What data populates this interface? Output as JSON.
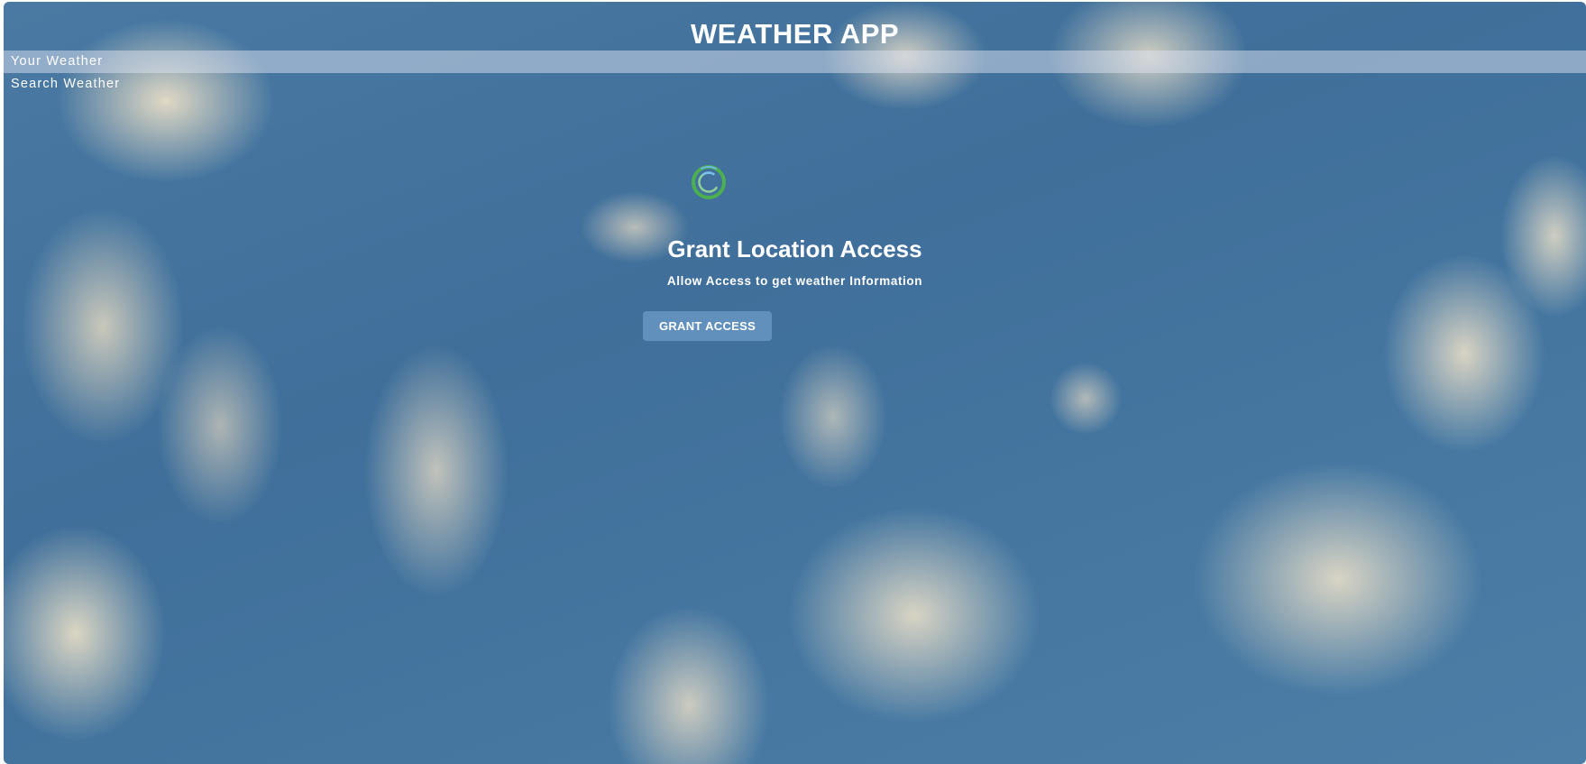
{
  "app": {
    "title": "WEATHER APP"
  },
  "tabs": [
    {
      "label": "Your Weather",
      "active": true
    },
    {
      "label": "Search Weather",
      "active": false
    }
  ],
  "grant": {
    "icon": "location-radar-icon",
    "title": "Grant Location Access",
    "subtitle": "Allow Access to get weather Information",
    "button_label": "GRANT ACCESS"
  },
  "colors": {
    "sky": "#4577a1",
    "icon_green": "#4caf50",
    "icon_blue": "#6fb7e8",
    "button_bg": "#6e9bc8",
    "tab_active_bg": "#dbe2ef"
  }
}
